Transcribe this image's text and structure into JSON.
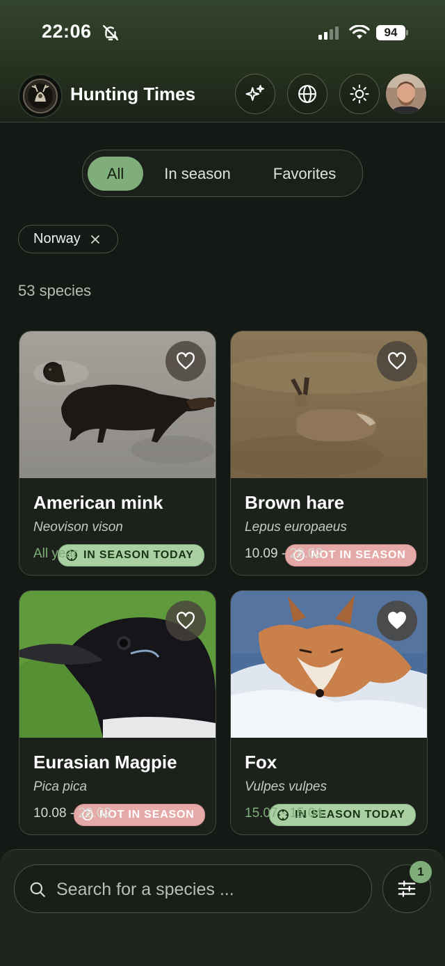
{
  "status_bar": {
    "time": "22:06",
    "battery": "94"
  },
  "app": {
    "title": "Hunting Times"
  },
  "segments": [
    {
      "label": "All",
      "active": true
    },
    {
      "label": "In season",
      "active": false
    },
    {
      "label": "Favorites",
      "active": false
    }
  ],
  "filter_chip": {
    "label": "Norway"
  },
  "species_count": "53 species",
  "cards": [
    {
      "name": "American mink",
      "latin": "Neovison vison",
      "dates": "All year",
      "status": "IN SEASON TODAY",
      "favorite": false
    },
    {
      "name": "Brown hare",
      "latin": "Lepus europaeus",
      "dates": "10.09 - 28.02",
      "status": "NOT IN SEASON",
      "favorite": false
    },
    {
      "name": "Eurasian Magpie",
      "latin": "Pica pica",
      "dates": "10.08 - 28.02",
      "status": "NOT IN SEASON",
      "favorite": false
    },
    {
      "name": "Fox",
      "latin": "Vulpes vulpes",
      "dates": "15.07 - 15.04",
      "status": "IN SEASON TODAY",
      "favorite": true
    }
  ],
  "search": {
    "placeholder": "Search for a species ..."
  },
  "filter_button": {
    "badge_count": "1"
  },
  "icons": {
    "bell": "bell-slash-icon",
    "ai": "sparkles-icon",
    "language": "globe-icon",
    "theme": "sun-icon",
    "favorite": "heart-icon",
    "search": "search-icon",
    "filter": "sliders-icon",
    "remove": "close-icon",
    "season": "crosshair-icon",
    "not_season": "slash-circle-icon"
  },
  "colors": {
    "accent": "#7fae7a",
    "in_season": "#a9cfa3",
    "not_in_season": "#e5a9a7",
    "background": "#141915"
  }
}
